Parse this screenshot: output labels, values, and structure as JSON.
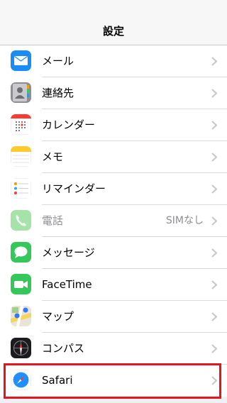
{
  "nav": {
    "title": "設定"
  },
  "rows": [
    {
      "label": "メール",
      "icon": "mail-icon"
    },
    {
      "label": "連絡先",
      "icon": "contacts-icon"
    },
    {
      "label": "カレンダー",
      "icon": "calendar-icon"
    },
    {
      "label": "メモ",
      "icon": "notes-icon"
    },
    {
      "label": "リマインダー",
      "icon": "reminders-icon"
    },
    {
      "label": "電話",
      "value": "SIMなし",
      "icon": "phone-icon",
      "disabled": true
    },
    {
      "label": "メッセージ",
      "icon": "messages-icon"
    },
    {
      "label": "FaceTime",
      "icon": "facetime-icon"
    },
    {
      "label": "マップ",
      "icon": "maps-icon"
    },
    {
      "label": "コンパス",
      "icon": "compass-icon"
    },
    {
      "label": "Safari",
      "icon": "safari-icon",
      "highlighted": true
    }
  ],
  "colors": {
    "highlight": "#e8141c",
    "background": "#efeff4"
  }
}
